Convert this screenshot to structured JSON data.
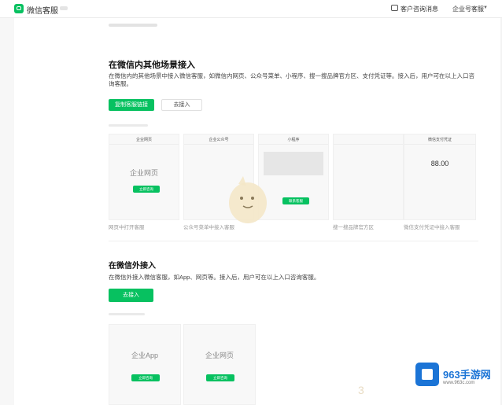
{
  "header": {
    "app_name": "微信客服",
    "messages_label": "客户咨询消息",
    "corp_label": "企业号客服"
  },
  "section_inside": {
    "title": "在微信内其他场景接入",
    "description": "在微信内的其他场景中接入微信客服，如微信内网页、公众号菜单、小程序、搜一搜品牌官方区、支付凭证等。接入后，用户可在以上入口咨询客服。",
    "primary_button": "复制客服链接",
    "secondary_button": "去接入",
    "scenes": [
      {
        "title": "企业网页",
        "big": "企业网页",
        "button": "立即咨询",
        "caption": "网页中打开客服"
      },
      {
        "title": "企业公众号",
        "big": "",
        "button": "",
        "caption": "公众号菜单中接入客服"
      },
      {
        "title": "小程序",
        "big": "",
        "button": "联系客服",
        "caption": ""
      },
      {
        "title": "",
        "big": "",
        "button": "",
        "caption": "搜一搜品牌官方区"
      },
      {
        "title": "微信支付凭证",
        "big": "88.00",
        "button": "",
        "caption": "微信支付凭证中接入客服"
      }
    ]
  },
  "section_outside": {
    "title": "在微信外接入",
    "description": "在微信外接入微信客服，如App、网页等。接入后，用户可在以上入口咨询客服。",
    "button": "去接入",
    "scenes": [
      {
        "big": "企业App",
        "button": "立即咨询"
      },
      {
        "big": "企业网页",
        "button": "立即咨询"
      }
    ]
  },
  "watermark": {
    "brand": "963手游网",
    "url": "www.963c.com"
  }
}
